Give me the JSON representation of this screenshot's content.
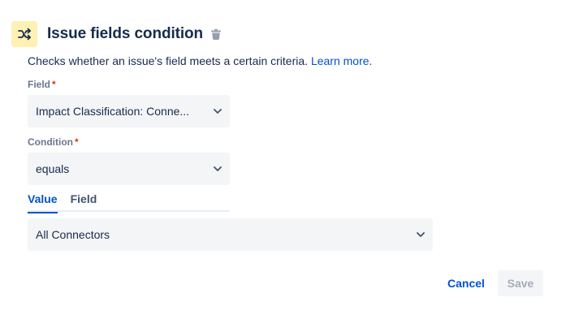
{
  "header": {
    "title": "Issue fields condition"
  },
  "description": {
    "text": "Checks whether an issue's field meets a certain criteria. ",
    "link": "Learn more."
  },
  "field": {
    "label": "Field",
    "required_mark": "*",
    "value": "Impact Classification: Conne..."
  },
  "condition": {
    "label": "Condition",
    "required_mark": "*",
    "value": "equals"
  },
  "tabs": [
    {
      "label": "Value",
      "active": true
    },
    {
      "label": "Field",
      "active": false
    }
  ],
  "value_select": {
    "value": "All Connectors"
  },
  "actions": {
    "cancel": "Cancel",
    "save": "Save"
  },
  "icons": {
    "header": "shuffle-icon",
    "delete": "trash-icon",
    "dropdown": "chevron-down-icon"
  },
  "colors": {
    "accent": "#0052CC",
    "icon_bg": "#FFF0B3",
    "required": "#DE350B",
    "field_bg": "#F4F5F7"
  }
}
